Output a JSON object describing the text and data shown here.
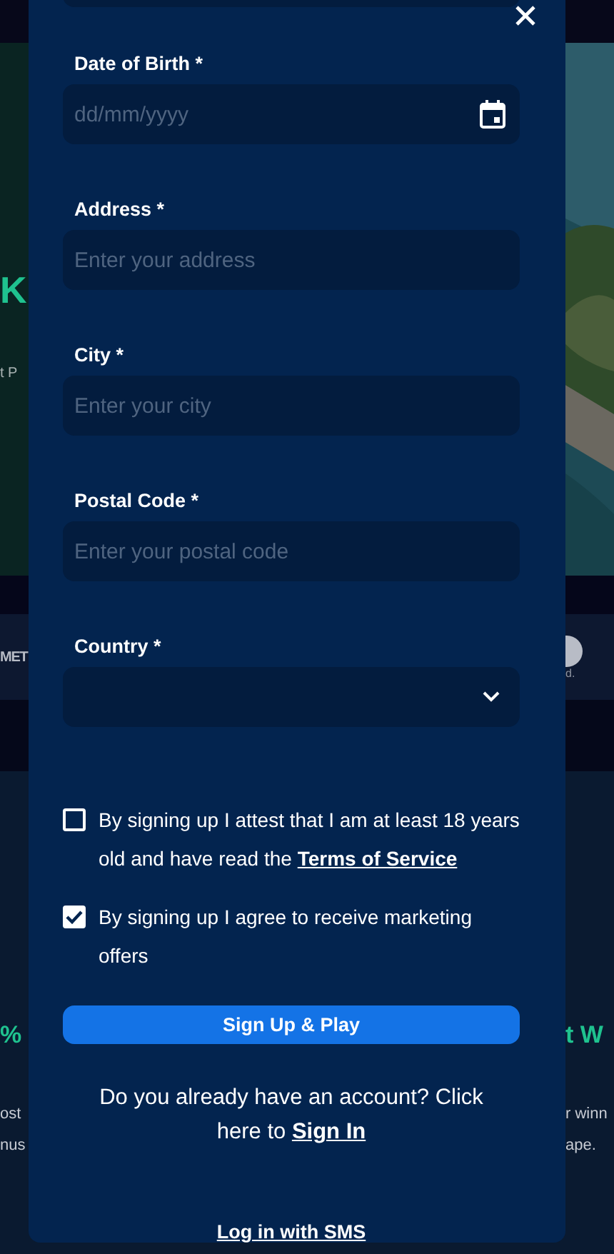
{
  "background": {
    "hero_letter": "K",
    "hero_subtitle": "t P",
    "strip_text": "MET",
    "strip_caption": "d.",
    "promo_left": {
      "title": "%",
      "lines": [
        "ost",
        "nus"
      ]
    },
    "promo_right": {
      "title": "t W",
      "lines": [
        "r winn",
        "ape."
      ]
    }
  },
  "fields": [
    {
      "kind": "date",
      "label": "Date of Birth *",
      "placeholder": "dd/mm/yyyy"
    },
    {
      "kind": "text",
      "label": "Address *",
      "placeholder": "Enter your address"
    },
    {
      "kind": "text",
      "label": "City *",
      "placeholder": "Enter your city"
    },
    {
      "kind": "text",
      "label": "Postal Code *",
      "placeholder": "Enter your postal code"
    },
    {
      "kind": "select",
      "label": "Country *"
    }
  ],
  "consents": [
    {
      "text": "By signing up I attest that I am at least 18 years old and have read the",
      "link": "Terms of Service",
      "checked": false
    },
    {
      "text": "By signing up I agree to receive marketing offers",
      "checked": true
    }
  ],
  "submit": "Sign Up & Play",
  "account_prompt": "Do you already have an account? Click here to",
  "sign_in_link": "Sign In",
  "sms_link": "Log in with SMS"
}
